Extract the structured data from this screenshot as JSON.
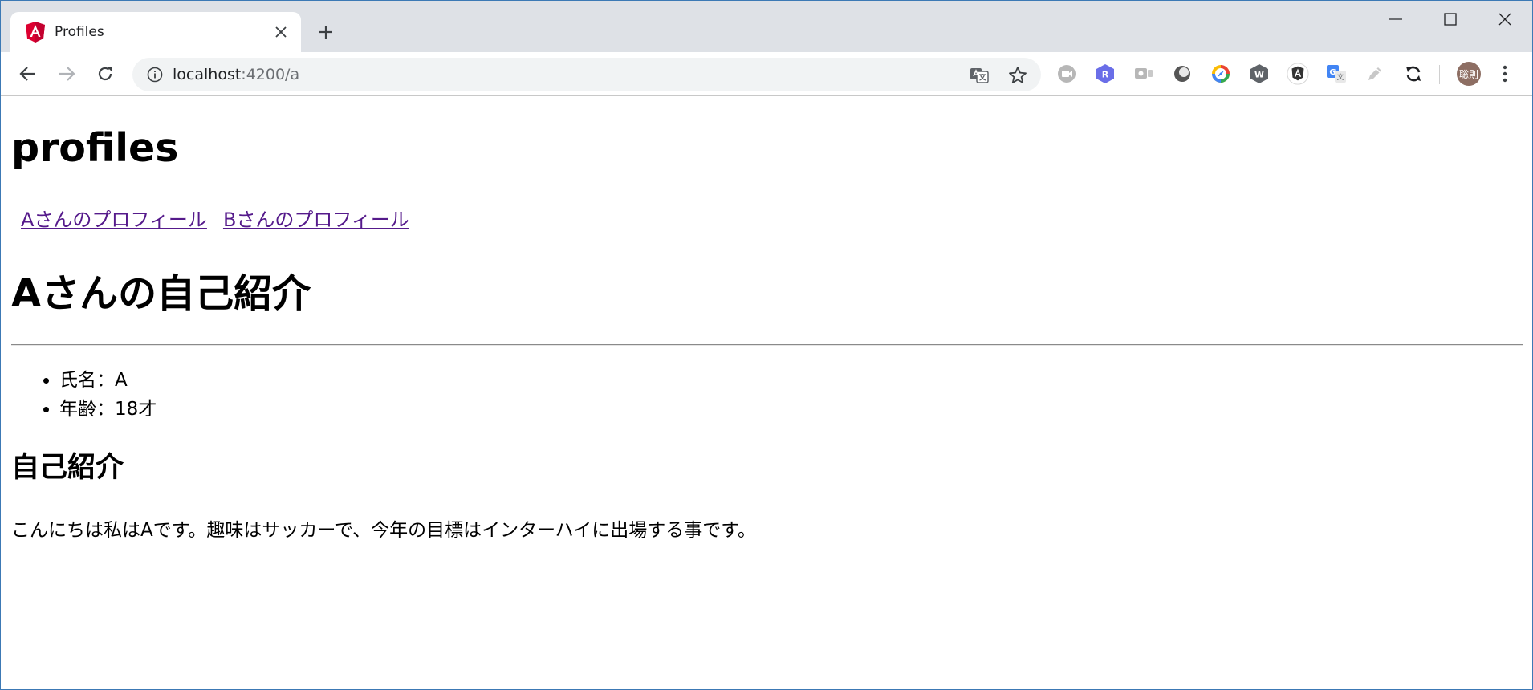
{
  "browser": {
    "tab": {
      "title": "Profiles",
      "favicon": "angular-icon"
    },
    "omnibox": {
      "host": "localhost",
      "path": ":4200/a"
    },
    "avatar_label": "聡則",
    "colors": {
      "tabstrip": "#dee1e6",
      "omnibox": "#f1f3f4",
      "angular_red": "#dd0031",
      "link_visited": "#551a8b"
    }
  },
  "page": {
    "title": "profiles",
    "nav_links": [
      "Aさんのプロフィール",
      "Bさんのプロフィール"
    ],
    "section_title": "Aさんの自己紹介",
    "info": [
      "氏名：A",
      "年齢：18才"
    ],
    "intro_heading": "自己紹介",
    "intro_text": "こんにちは私はAです。趣味はサッカーで、今年の目標はインターハイに出場する事です。"
  }
}
